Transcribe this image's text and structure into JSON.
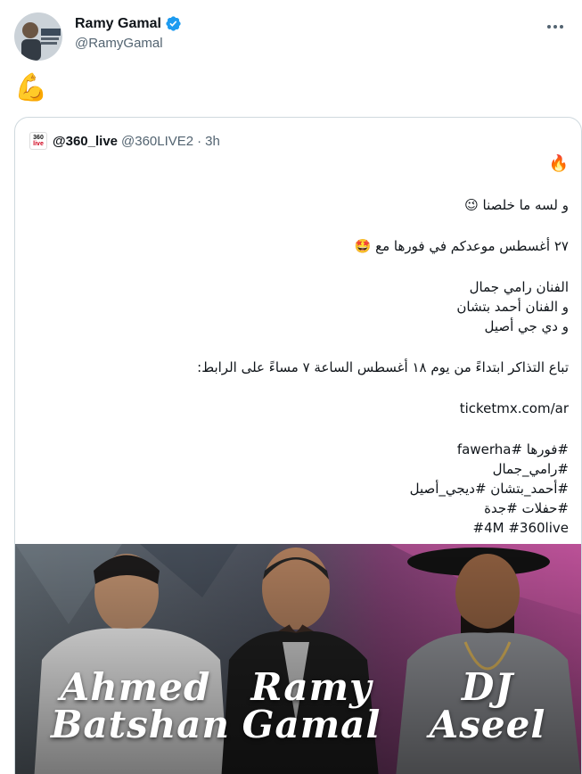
{
  "author": {
    "display_name": "Ramy Gamal",
    "handle": "@RamyGamal",
    "avatar_text_1": "Ramy Gamal",
    "avatar_text_2": "Tour Mode"
  },
  "tweet": {
    "text": "💪"
  },
  "quoted": {
    "logo_text_top": "360",
    "logo_text_bottom": "live",
    "name": "@360_live",
    "handle": "@360LIVE2",
    "separator": "·",
    "time": "3h",
    "lines": [
      "🔥",
      "و لسه ما خلصنا 😉",
      "٢٧ أغسطس موعدكم في فورها مع 🤩",
      "الفنان رامي جمال",
      "و الفنان أحمد بتشان",
      "و دي جي أصيل",
      "تباع التذاكر ابتداءً من يوم ١٨ أغسطس الساعة ٧ مساءً على الرابط:",
      "ticketmx.com/ar",
      "#فورها #fawerha",
      "#رامي_جمال",
      "#أحمد_بتشان #ديجي_أصيل",
      "#حفلات #جدة",
      "#4M #360live"
    ],
    "image": {
      "caption_1": "Ahmed Batshan",
      "caption_2": "Ramy Gamal",
      "caption_3": "DJ Aseel"
    }
  },
  "colors": {
    "verified": "#1d9bf0",
    "secondary_text": "#536471",
    "border": "#cfd9de"
  }
}
